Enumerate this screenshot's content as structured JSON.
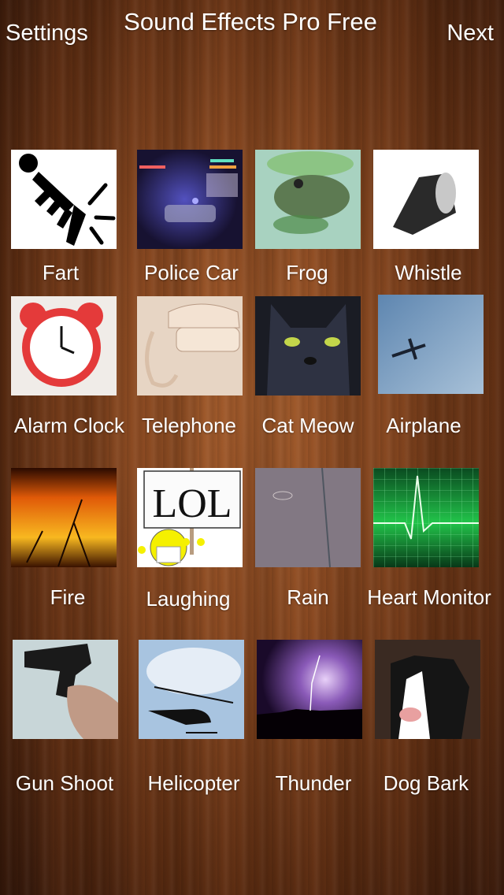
{
  "header": {
    "title": "Sound Effects Pro Free",
    "left_button": "Settings",
    "right_button": "Next"
  },
  "sounds": [
    {
      "label": "Fart",
      "icon": "fart-figure-icon"
    },
    {
      "label": "Police Car",
      "icon": "police-car-image"
    },
    {
      "label": "Frog",
      "icon": "frog-image"
    },
    {
      "label": "Whistle",
      "icon": "whistle-image"
    },
    {
      "label": "Alarm Clock",
      "icon": "alarm-clock-image"
    },
    {
      "label": "Telephone",
      "icon": "telephone-image"
    },
    {
      "label": "Cat Meow",
      "icon": "cat-image"
    },
    {
      "label": "Airplane",
      "icon": "airplane-image"
    },
    {
      "label": "Fire",
      "icon": "fire-image"
    },
    {
      "label": "Laughing",
      "icon": "lol-sign-image"
    },
    {
      "label": "Rain",
      "icon": "rain-image"
    },
    {
      "label": "Heart Monitor",
      "icon": "heart-monitor-image"
    },
    {
      "label": "Gun Shoot",
      "icon": "gun-image"
    },
    {
      "label": "Helicopter",
      "icon": "helicopter-image"
    },
    {
      "label": "Thunder",
      "icon": "lightning-image"
    },
    {
      "label": "Dog Bark",
      "icon": "dog-image"
    }
  ],
  "lol_text": "LOL"
}
